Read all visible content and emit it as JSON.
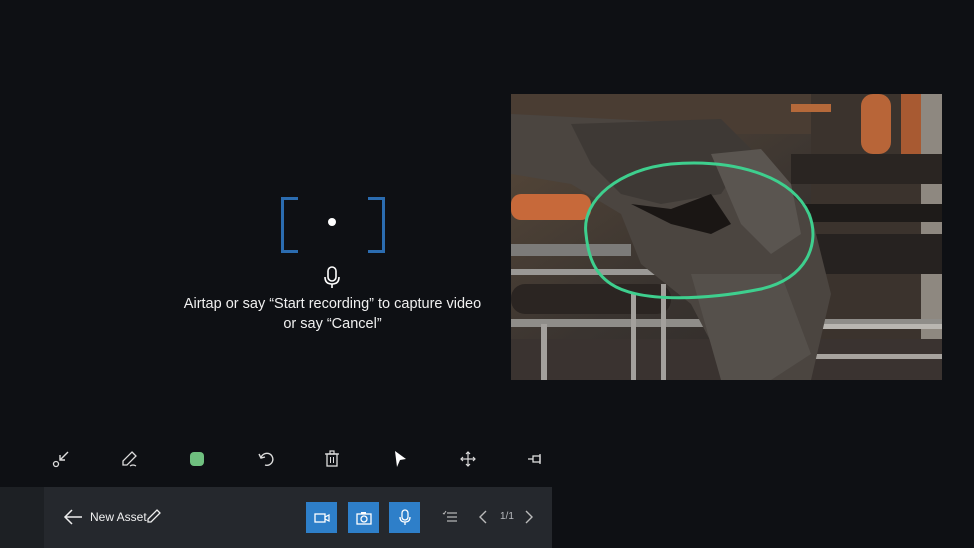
{
  "capture": {
    "instruction_line1": "Airtap or say “Start recording” to capture video",
    "instruction_line2": "or say “Cancel”"
  },
  "toolbar": {
    "tools": [
      "collapse-icon",
      "pen-icon",
      "color-swatch",
      "undo-icon",
      "delete-icon",
      "cursor-icon",
      "move-icon",
      "pin-icon"
    ],
    "swatch_color": "#6fc07f"
  },
  "bottombar": {
    "title": "New Asset",
    "page_indicator": "1/1",
    "accent_color": "#2e7fc9"
  },
  "annotation": {
    "stroke_color": "#3ecf8e"
  }
}
